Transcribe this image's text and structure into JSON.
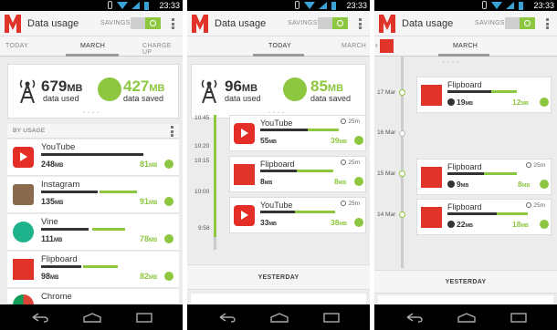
{
  "status_bar": {
    "time": "23:33"
  },
  "app": {
    "title": "Data usage",
    "savings_label": "SAVINGS",
    "colors": {
      "accent_green": "#8dc63f",
      "brand_red": "#e0342b",
      "dark_bar": "#333333"
    }
  },
  "screen1": {
    "tabs": [
      "TODAY",
      "MARCH",
      "CHARGE UP"
    ],
    "active_tab": "MARCH",
    "summary": {
      "used_value": "679",
      "used_unit": "MB",
      "used_caption": "data used",
      "saved_value": "427",
      "saved_unit": "MB",
      "saved_caption": "data saved",
      "pager": "• • • •"
    },
    "list_header": "BY USAGE",
    "apps": [
      {
        "name": "YouTube",
        "used": "248",
        "unit": "MB",
        "saved": "81",
        "saved_unit": "MB",
        "icon": "youtube-icon",
        "used_pct": 0.84,
        "saved_pct": 0.0
      },
      {
        "name": "Instagram",
        "used": "135",
        "unit": "MB",
        "saved": "91",
        "saved_unit": "MB",
        "icon": "instagram-icon",
        "used_pct": 0.46,
        "saved_pct": 0.31
      },
      {
        "name": "Vine",
        "used": "111",
        "unit": "MB",
        "saved": "78",
        "saved_unit": "MB",
        "icon": "vine-icon",
        "used_pct": 0.38,
        "saved_pct": 0.27
      },
      {
        "name": "Flipboard",
        "used": "98",
        "unit": "MB",
        "saved": "82",
        "saved_unit": "MB",
        "icon": "flipboard-icon",
        "used_pct": 0.33,
        "saved_pct": 0.28
      },
      {
        "name": "Chrome",
        "icon": "chrome-icon"
      }
    ]
  },
  "screen2": {
    "tabs": [
      "TODAY",
      "MARCH"
    ],
    "active_tab": "TODAY",
    "summary": {
      "used_value": "96",
      "used_unit": "MB",
      "used_caption": "data used",
      "saved_value": "85",
      "saved_unit": "MB",
      "saved_caption": "data saved",
      "pager": "• • • •"
    },
    "times": [
      "10:45",
      "10:20",
      "10:15",
      "10:00",
      "9:58"
    ],
    "sessions": [
      {
        "name": "YouTube",
        "duration": "25m",
        "used": "55",
        "unit": "MB",
        "saved": "39",
        "saved_unit": "MB",
        "icon": "youtube-icon"
      },
      {
        "name": "Flipboard",
        "duration": "25m",
        "used": "8",
        "unit": "MB",
        "saved": "8",
        "saved_unit": "MB",
        "icon": "flipboard-icon"
      },
      {
        "name": "YouTube",
        "duration": "25m",
        "used": "33",
        "unit": "MB",
        "saved": "38",
        "saved_unit": "MB",
        "icon": "youtube-icon"
      }
    ],
    "yesterday_label": "YESTERDAY"
  },
  "screen3": {
    "tabs": [
      "MARCH"
    ],
    "active_tab": "MARCH",
    "dates": [
      "17 Mar",
      "16 Mar",
      "15 Mar",
      "14 Mar"
    ],
    "sessions": [
      {
        "name": "Flipboard",
        "duration": "25m",
        "used": "19",
        "unit": "MB",
        "saved": "12",
        "saved_unit": "MB",
        "icon": "flipboard-icon"
      },
      {
        "name": "Flipboard",
        "duration": "25m",
        "used": "9",
        "unit": "MB",
        "saved": "8",
        "saved_unit": "MB",
        "icon": "flipboard-icon"
      },
      {
        "name": "Flipboard",
        "duration": "25m",
        "used": "22",
        "unit": "MB",
        "saved": "18",
        "saved_unit": "MB",
        "icon": "flipboard-icon"
      }
    ],
    "yesterday_label": "YESTERDAY"
  }
}
